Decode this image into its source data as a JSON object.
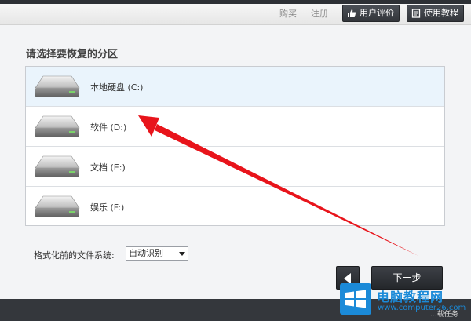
{
  "header": {
    "buy_label": "购买",
    "register_label": "注册",
    "review_label": "用户评价",
    "tutorial_label": "使用教程"
  },
  "main": {
    "title": "请选择要恢复的分区",
    "partitions": [
      {
        "label": "本地硬盘 (C:)",
        "selected": true
      },
      {
        "label": "软件 (D:)",
        "selected": false
      },
      {
        "label": "文档 (E:)",
        "selected": false
      },
      {
        "label": "娱乐 (F:)",
        "selected": false
      }
    ],
    "fs_label": "格式化前的文件系统:",
    "fs_value": "自动识别"
  },
  "nav": {
    "next_label": "下一步"
  },
  "watermark": {
    "title": "电脑教程网",
    "url": "www.computer26.com",
    "extra": "...载任务"
  },
  "colors": {
    "annotation_arrow": "#e8141b",
    "watermark_blue": "#1b8ad8",
    "button_dark": "#33363b"
  },
  "icons": {
    "review": "thumbs-up-icon",
    "tutorial": "book-icon",
    "drive": "hard-drive-icon",
    "back": "arrow-left-icon",
    "watermark": "windows-logo-icon"
  }
}
